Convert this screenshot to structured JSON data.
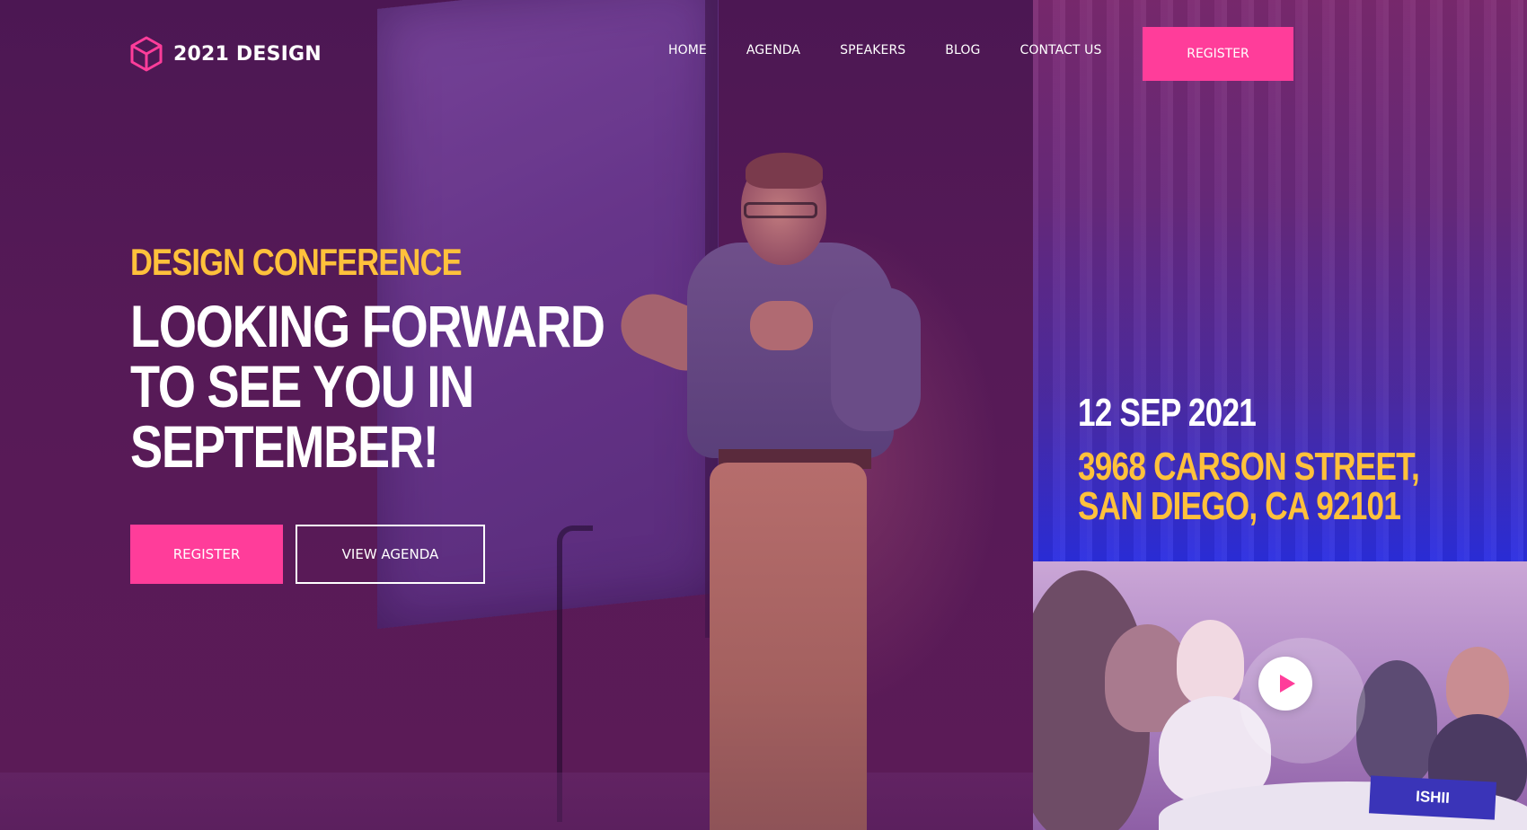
{
  "brand": {
    "name": "2021 DESIGN",
    "logo_icon": "cube-icon",
    "accent_color": "#ff3d9a"
  },
  "nav": {
    "items": [
      "HOME",
      "AGENDA",
      "SPEAKERS",
      "BLOG",
      "CONTACT US"
    ],
    "register_label": "REGISTER"
  },
  "hero": {
    "eyebrow": "DESIGN CONFERENCE",
    "headline_lines": [
      "LOOKING FORWARD",
      "TO SEE YOU IN",
      "SEPTEMBER!"
    ],
    "primary_cta": "REGISTER",
    "secondary_cta": "VIEW AGENDA",
    "highlight_color": "#ffc13b"
  },
  "event": {
    "date": "12 SEP 2021",
    "address_lines": [
      "3968 CARSON STREET,",
      "SAN DIEGO, CA 92101"
    ]
  },
  "video": {
    "play_icon": "play-icon",
    "name_card": "ISHII"
  }
}
